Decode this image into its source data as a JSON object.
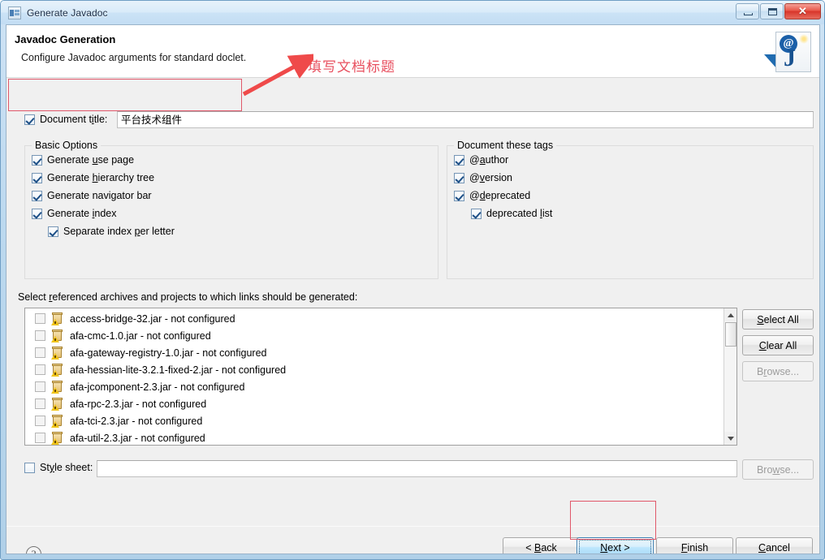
{
  "window": {
    "title": "Generate Javadoc",
    "icon": "javadoc-window-icon",
    "controls": {
      "minimize": "minimize-button",
      "maximize": "maximize-button",
      "close_glyph": "✕"
    }
  },
  "header": {
    "title": "Javadoc Generation",
    "subtitle": "Configure Javadoc arguments for standard doclet.",
    "banner_icon_at": "@",
    "banner_icon_j": "J"
  },
  "document_title": {
    "checkbox_label_pre": "Document t",
    "checkbox_label_underline": "i",
    "checkbox_label_post": "tle:",
    "checked": true,
    "value": "平台技术组件"
  },
  "basic_options": {
    "legend": "Basic Options",
    "items": [
      {
        "pre": "Generate ",
        "u": "u",
        "post": "se page",
        "checked": true,
        "indent": 0
      },
      {
        "pre": "Generate ",
        "u": "h",
        "post": "ierarchy tree",
        "checked": true,
        "indent": 0
      },
      {
        "pre": "Generate navi",
        "u": "g",
        "post": "ator bar",
        "checked": true,
        "indent": 0
      },
      {
        "pre": "Generate ",
        "u": "i",
        "post": "ndex",
        "checked": true,
        "indent": 0
      },
      {
        "pre": "Separate index ",
        "u": "p",
        "post": "er letter",
        "checked": true,
        "indent": 1
      }
    ]
  },
  "document_tags": {
    "legend": "Document these tags",
    "items": [
      {
        "pre": "@",
        "u": "a",
        "post": "uthor",
        "checked": true,
        "indent": 0
      },
      {
        "pre": "@",
        "u": "v",
        "post": "ersion",
        "checked": true,
        "indent": 0
      },
      {
        "pre": "@",
        "u": "d",
        "post": "eprecated",
        "checked": true,
        "indent": 0
      },
      {
        "pre": "deprecated ",
        "u": "l",
        "post": "ist",
        "checked": true,
        "indent": 1
      }
    ]
  },
  "references": {
    "label_pre": "Select ",
    "label_u": "r",
    "label_post": "eferenced archives and projects to which links should be generated:",
    "items": [
      {
        "name": "access-bridge-32.jar - not configured",
        "checked": false
      },
      {
        "name": "afa-cmc-1.0.jar - not configured",
        "checked": false
      },
      {
        "name": "afa-gateway-registry-1.0.jar - not configured",
        "checked": false
      },
      {
        "name": "afa-hessian-lite-3.2.1-fixed-2.jar - not configured",
        "checked": false
      },
      {
        "name": "afa-jcomponent-2.3.jar - not configured",
        "checked": false
      },
      {
        "name": "afa-rpc-2.3.jar - not configured",
        "checked": false
      },
      {
        "name": "afa-tci-2.3.jar - not configured",
        "checked": false
      },
      {
        "name": "afa-util-2.3.jar - not configured",
        "checked": false
      }
    ],
    "buttons": {
      "select_all": {
        "pre": "",
        "u": "S",
        "post": "elect All",
        "enabled": true
      },
      "clear_all": {
        "pre": "",
        "u": "C",
        "post": "lear All",
        "enabled": true
      },
      "browse": {
        "pre": "B",
        "u": "r",
        "post": "owse...",
        "enabled": false
      }
    }
  },
  "stylesheet": {
    "label_pre": "St",
    "label_u": "y",
    "label_post": "le sheet:",
    "checked": false,
    "value": "",
    "browse": {
      "pre": "Bro",
      "u": "w",
      "post": "se...",
      "enabled": false
    }
  },
  "footer": {
    "help": "?",
    "buttons": [
      {
        "pre": "< ",
        "u": "B",
        "post": "ack",
        "state": "normal",
        "name": "back-button"
      },
      {
        "pre": "",
        "u": "N",
        "post": "ext >",
        "state": "default-focus",
        "name": "next-button"
      },
      {
        "pre": "",
        "u": "F",
        "post": "inish",
        "state": "normal",
        "name": "finish-button"
      },
      {
        "pre": "",
        "u": "C",
        "post": "ancel",
        "state": "normal",
        "name": "cancel-button"
      }
    ]
  },
  "annotations": {
    "text": "填写文档标题",
    "accent_color": "#e8505f"
  }
}
